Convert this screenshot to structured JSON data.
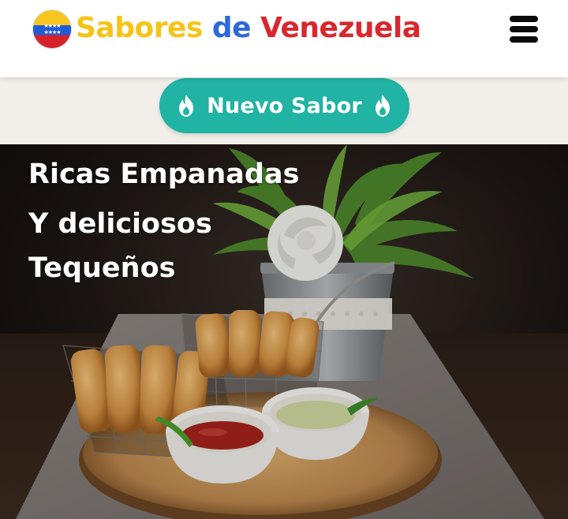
{
  "header": {
    "logo_icon": "venezuela-flag-logo",
    "title_part1": "Sabores",
    "title_part2": "de",
    "title_part3": "Venezuela",
    "menu_icon": "hamburger-menu-icon"
  },
  "cta": {
    "label": "Nuevo Sabor",
    "icon": "fire-icon"
  },
  "hero": {
    "line1": "Ricas Empanadas",
    "line2": "Y deliciosos",
    "line3": "Tequeños",
    "image": "tequeños in wire basket with dipping sauces"
  },
  "colors": {
    "yellow": "#f6c417",
    "blue": "#2e68d9",
    "red": "#d9272d",
    "teal": "#21b3a3",
    "band": "#f2efea"
  }
}
